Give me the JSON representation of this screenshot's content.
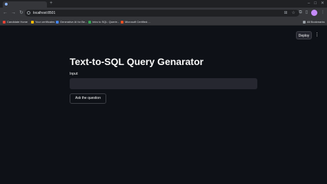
{
  "browser": {
    "url": "localhost:8501",
    "bookmarks": [
      {
        "label": "Candidate Home",
        "color": "#ea4335"
      },
      {
        "label": "Your certificates",
        "color": "#fbbc04"
      },
      {
        "label": "Generative AI for Be...",
        "color": "#4285f4"
      },
      {
        "label": "Intro to SQL: Querie...",
        "color": "#34a853"
      },
      {
        "label": "Microsoft Certified:...",
        "color": "#f25022"
      }
    ],
    "all_bookmarks": "All Bookmarks"
  },
  "app": {
    "deploy_label": "Deploy",
    "title": "Text-to-SQL Query Genarator",
    "input_label": "Input:",
    "input_value": "",
    "ask_button": "Ask the question"
  },
  "icons": {
    "back": "←",
    "forward": "→",
    "reload": "↻",
    "star": "☆",
    "menu": "⋮"
  }
}
